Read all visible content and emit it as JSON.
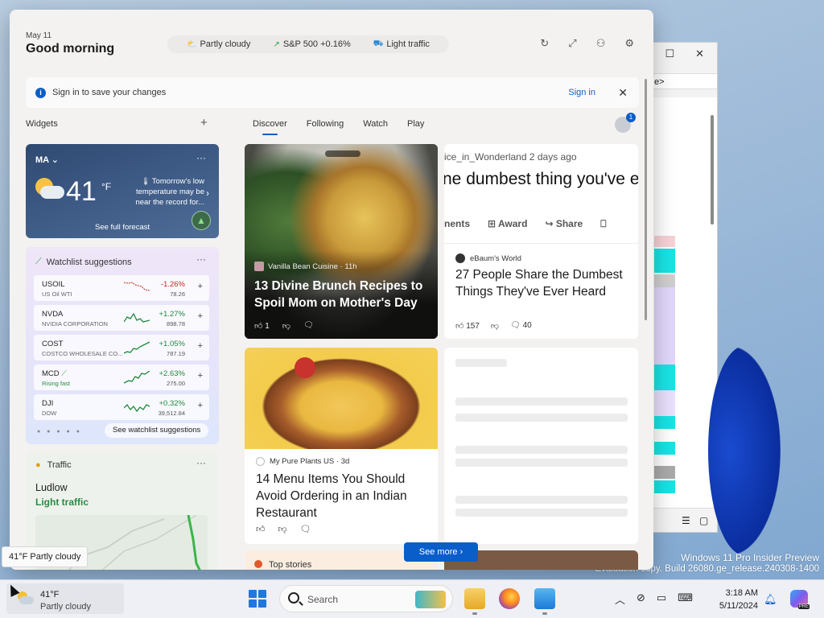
{
  "background_window": {
    "address_text": "e>",
    "colors": [
      "#f7d2d6",
      "#19e3e5",
      "#cfcfd0",
      "#e1d7fa",
      "#e8e0fc",
      "#19e3e5",
      "#aaaaaa"
    ]
  },
  "watermark": {
    "line1": "Windows 11 Pro Insider Preview",
    "line2": "Evaluation copy. Build 26080.ge_release.240308-1400"
  },
  "header": {
    "date": "May 11",
    "greeting": "Good morning",
    "chips": [
      {
        "icon": "partly-cloudy-icon",
        "label": "Partly cloudy"
      },
      {
        "icon": "stock-trend-icon",
        "label": "S&P 500 +0.16%"
      },
      {
        "icon": "traffic-icon",
        "label": "Light traffic"
      }
    ]
  },
  "signin_bar": {
    "message": "Sign in to save your changes",
    "link": "Sign in"
  },
  "widgets_section": {
    "title": "Widgets"
  },
  "feed_tabs": [
    {
      "label": "Discover",
      "active": true
    },
    {
      "label": "Following",
      "active": false
    },
    {
      "label": "Watch",
      "active": false
    },
    {
      "label": "Play",
      "active": false
    }
  ],
  "profile_badge": "1",
  "weather": {
    "location": "MA",
    "temperature": "41",
    "unit": "°F",
    "note": "Tomorrow's low temperature may be near the record for...",
    "cta": "See full forecast"
  },
  "watchlist": {
    "title": "Watchlist suggestions",
    "rows": [
      {
        "symbol": "USOIL",
        "name": "US Oil WTI",
        "change": "-1.26%",
        "price": "78.26",
        "direction": "down"
      },
      {
        "symbol": "NVDA",
        "name": "NVIDIA CORPORATION",
        "change": "+1.27%",
        "price": "898.78",
        "direction": "up"
      },
      {
        "symbol": "COST",
        "name": "COSTCO WHOLESALE CO...",
        "change": "+1.05%",
        "price": "787.19",
        "direction": "up"
      },
      {
        "symbol": "MCD",
        "name": "Rising fast",
        "change": "+2.63%",
        "price": "275.00",
        "direction": "up"
      },
      {
        "symbol": "DJI",
        "name": "DOW",
        "change": "+0.32%",
        "price": "39,512.84",
        "direction": "up"
      }
    ],
    "see_more": "See watchlist suggestions"
  },
  "traffic": {
    "title": "Traffic",
    "city": "Ludlow",
    "status": "Light traffic"
  },
  "feed": {
    "card1": {
      "source": "Vanilla Bean Cuisine · 11h",
      "title": "13 Divine Brunch Recipes to Spoil Mom on Mother's Day",
      "likes": "1"
    },
    "card2": {
      "screenshot_user": "ice_in_Wonderland 2 days ago",
      "screenshot_headline": "ne dumbest thing you've e",
      "screenshot_actions": [
        "nents",
        "Award",
        "Share"
      ],
      "source": "eBaum's World",
      "title": "27 People Share the Dumbest Things They've Ever Heard",
      "likes": "157",
      "comments": "40"
    },
    "card3": {
      "source": "My Pure Plants US · 3d",
      "title": "14 Menu Items You Should Avoid Ordering in an Indian Restaurant"
    },
    "card5": {
      "title": "Top stories"
    },
    "see_more": "See more"
  },
  "tooltip": "41°F Partly cloudy",
  "taskbar": {
    "weather_temp": "41°F",
    "weather_desc": "Partly cloudy",
    "search_placeholder": "Search",
    "time": "3:18 AM",
    "date": "5/11/2024"
  }
}
